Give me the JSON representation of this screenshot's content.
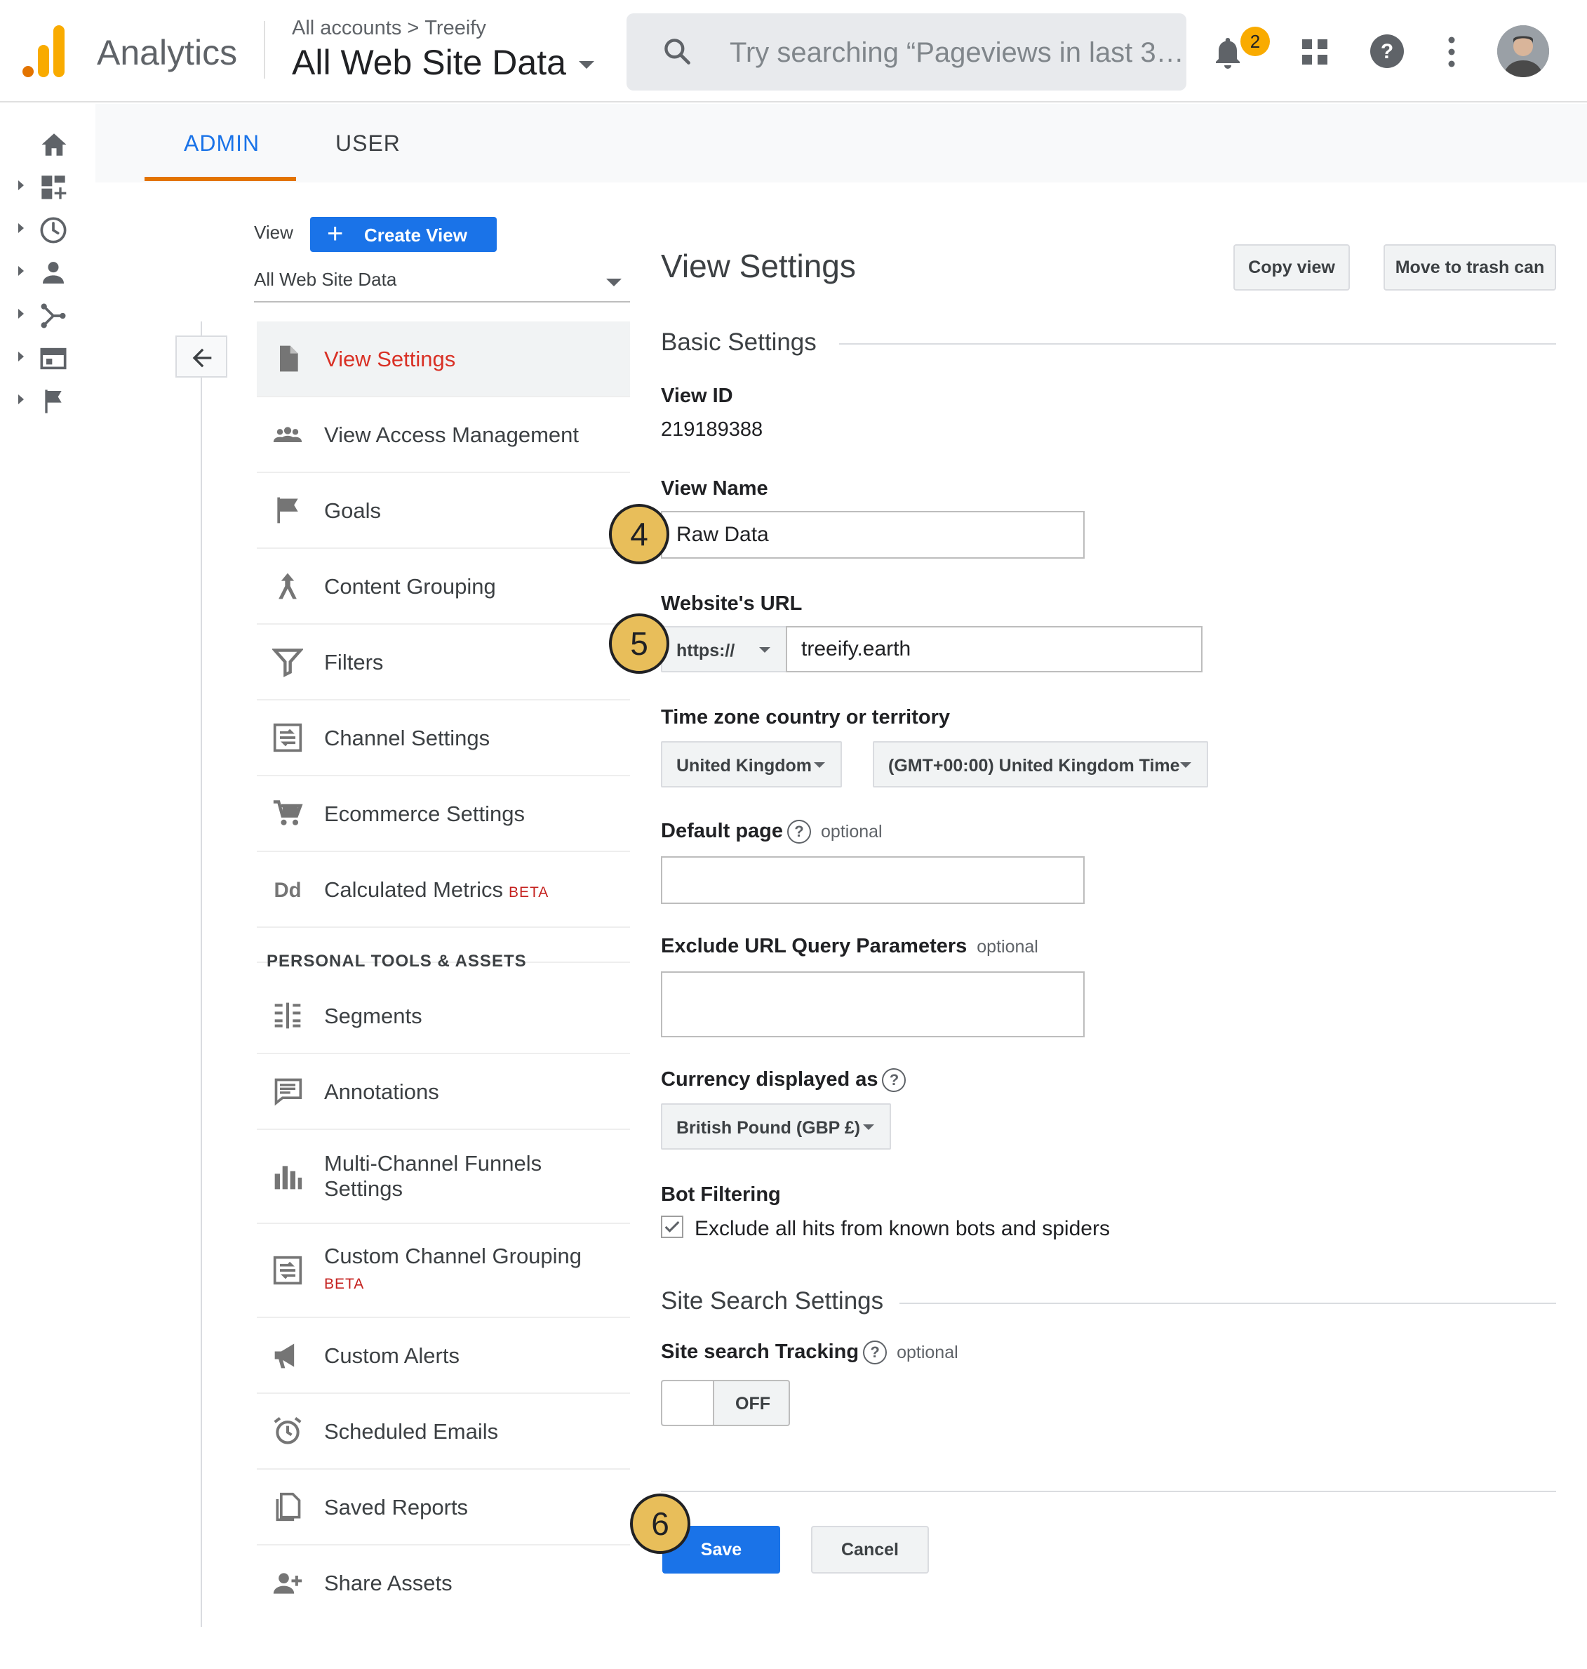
{
  "header": {
    "app_name": "Analytics",
    "breadcrumb": {
      "root": "All accounts",
      "separator": ">",
      "account": "Treeify"
    },
    "property_view": "All Web Site Data",
    "search_placeholder": "Try searching “Pageviews in last 3…",
    "notification_count": "2",
    "icons": [
      "search-icon",
      "bell-icon",
      "apps-grid-icon",
      "help-icon",
      "more-vert-icon",
      "avatar"
    ]
  },
  "rail": {
    "icons": [
      "home-icon",
      "customization-icon",
      "realtime-clock-icon",
      "audience-person-icon",
      "acquisition-icon",
      "behavior-icon",
      "conversions-flag-icon"
    ]
  },
  "tabs": {
    "admin": "ADMIN",
    "user": "USER",
    "active": "ADMIN"
  },
  "view_column": {
    "label": "View",
    "create_button": "Create View",
    "selected_view": "All Web Site Data"
  },
  "nav": {
    "items": [
      {
        "label": "View Settings",
        "icon": "document-icon",
        "active": true
      },
      {
        "label": "View Access Management",
        "icon": "people-icon"
      },
      {
        "label": "Goals",
        "icon": "flag-icon"
      },
      {
        "label": "Content Grouping",
        "icon": "content-grouping-icon"
      },
      {
        "label": "Filters",
        "icon": "filter-icon"
      },
      {
        "label": "Channel Settings",
        "icon": "channel-settings-icon"
      },
      {
        "label": "Ecommerce Settings",
        "icon": "cart-icon"
      },
      {
        "label": "Calculated Metrics",
        "badge": "BETA",
        "icon": "dd-icon"
      }
    ],
    "section_heading": "PERSONAL TOOLS & ASSETS",
    "personal_items": [
      {
        "label": "Segments",
        "icon": "segments-icon"
      },
      {
        "label": "Annotations",
        "icon": "annotations-icon"
      },
      {
        "label": "Multi-Channel Funnels",
        "label2": "Settings",
        "icon": "bar-chart-icon"
      },
      {
        "label": "Custom Channel Grouping",
        "badge": "BETA",
        "icon": "channel-settings-icon"
      },
      {
        "label": "Custom Alerts",
        "icon": "megaphone-icon"
      },
      {
        "label": "Scheduled Emails",
        "icon": "alarm-clock-icon"
      },
      {
        "label": "Saved Reports",
        "icon": "saved-report-icon"
      },
      {
        "label": "Share Assets",
        "icon": "person-add-icon"
      }
    ]
  },
  "settings": {
    "title": "View Settings",
    "copy_view": "Copy view",
    "trash": "Move to trash can",
    "basic_title": "Basic Settings",
    "view_id_label": "View ID",
    "view_id": "219189388",
    "view_name_label": "View Name",
    "view_name": "Raw Data",
    "url_label": "Website's URL",
    "protocol": "https://",
    "url": "treeify.earth",
    "tz_label": "Time zone country or territory",
    "tz_country": "United Kingdom",
    "tz_zone": "(GMT+00:00) United Kingdom Time",
    "default_page_label": "Default page",
    "optional": "optional",
    "default_page": "",
    "exclude_label": "Exclude URL Query Parameters",
    "exclude": "",
    "currency_label": "Currency displayed as",
    "currency": "British Pound (GBP £)",
    "bot_label": "Bot Filtering",
    "bot_checkbox": "Exclude all hits from known bots and spiders",
    "bot_checked": true,
    "site_search_title": "Site Search Settings",
    "site_search_label": "Site search Tracking",
    "toggle_state": "OFF",
    "save": "Save",
    "cancel": "Cancel",
    "help_glyph": "?"
  },
  "steps": [
    "4",
    "5",
    "6"
  ],
  "colors": {
    "accent": "#1a73e8",
    "active_nav": "#d93025",
    "tab_underline": "#e37400",
    "step_marker": "#e8be5a",
    "badge": "#f9ab00"
  }
}
